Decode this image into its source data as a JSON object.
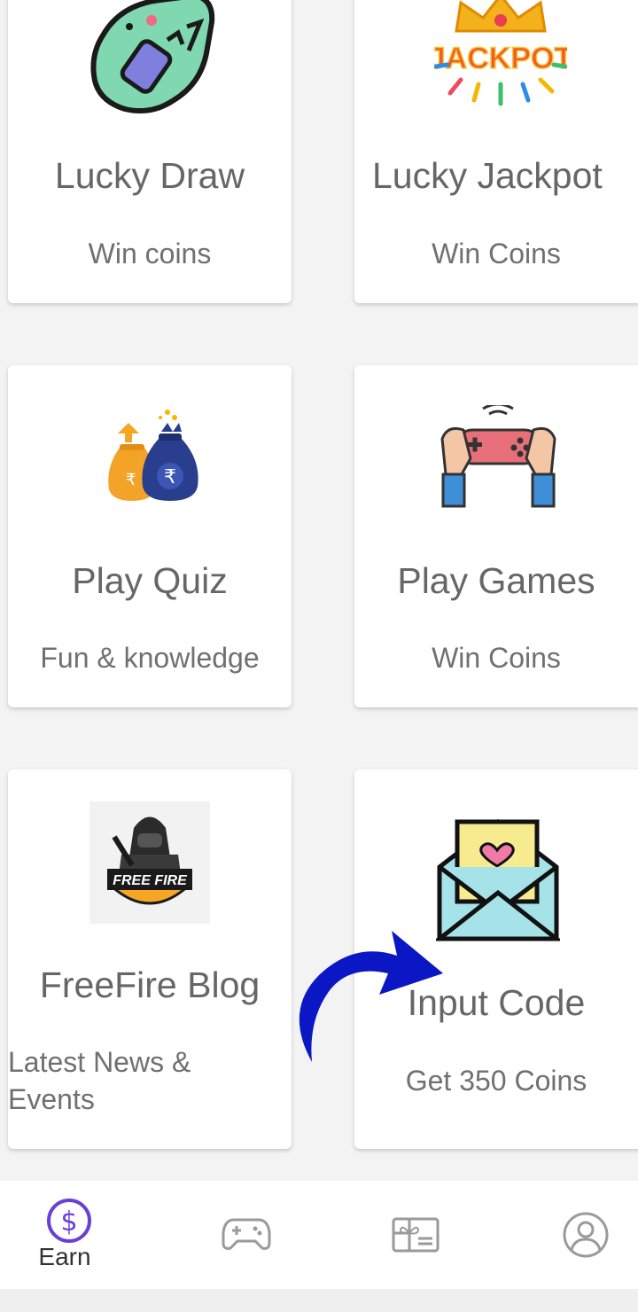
{
  "cards": [
    {
      "title": "Lucky Draw",
      "subtitle": "Win coins",
      "icon": "lucky-draw-ticket-icon"
    },
    {
      "title": "Lucky Jackpot",
      "subtitle": "Win Coins",
      "icon": "jackpot-icon",
      "icon_text": "JACKPOT"
    },
    {
      "title": "Play Quiz",
      "subtitle": "Fun & knowledge",
      "icon": "money-bags-icon",
      "icon_text": "₹"
    },
    {
      "title": "Play Games",
      "subtitle": "Win Coins",
      "icon": "gamepad-icon"
    },
    {
      "title": "FreeFire Blog",
      "subtitle_line1": "Latest News &",
      "subtitle_line2": "Events",
      "icon": "freefire-logo-icon",
      "icon_text": "FREE FIRE"
    },
    {
      "title": "Input Code",
      "subtitle": "Get 350 Coins",
      "icon": "love-letter-envelope-icon"
    }
  ],
  "annotation": {
    "icon": "curved-arrow-icon",
    "color": "#0b17c4"
  },
  "bottom_nav": {
    "active_color": "#6a3fd8",
    "items": [
      {
        "label": "Earn",
        "icon": "dollar-circle-icon",
        "active": true
      },
      {
        "label": "",
        "icon": "gamepad-nav-icon",
        "active": false
      },
      {
        "label": "",
        "icon": "gift-card-icon",
        "active": false
      },
      {
        "label": "",
        "icon": "profile-icon",
        "active": false
      }
    ]
  }
}
